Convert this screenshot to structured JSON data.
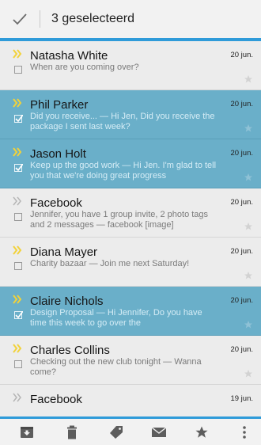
{
  "header": {
    "done_icon": "check-icon",
    "title": "3 geselecteerd",
    "accent": "#2f9bd9"
  },
  "messages": [
    {
      "sender": "Natasha White",
      "snippet": "When are you coming over?",
      "date": "20 jun.",
      "selected": false,
      "important": true
    },
    {
      "sender": "Phil Parker",
      "snippet": "Did you receive... — Hi Jen, Did you receive the package I sent last week?",
      "date": "20 jun.",
      "selected": true,
      "important": true
    },
    {
      "sender": "Jason Holt",
      "snippet": "Keep up the good work — Hi Jen. I'm glad to tell you that we're doing great progress",
      "date": "20 jun.",
      "selected": true,
      "important": true
    },
    {
      "sender": "Facebook",
      "snippet": "Jennifer, you have 1 group invite, 2 photo tags and 2 messages — facebook [image]",
      "date": "20 jun.",
      "selected": false,
      "important": false
    },
    {
      "sender": "Diana Mayer",
      "snippet": "Charity bazaar — Join me next Saturday!",
      "date": "20 jun.",
      "selected": false,
      "important": true
    },
    {
      "sender": "Claire Nichols",
      "snippet": "Design Proposal — Hi Jennifer, Do you have time this week to go over the",
      "date": "20 jun.",
      "selected": true,
      "important": true
    },
    {
      "sender": "Charles Collins",
      "snippet": "Checking out the new club tonight — Wanna come?",
      "date": "20 jun.",
      "selected": false,
      "important": true
    },
    {
      "sender": "Facebook",
      "snippet": "",
      "date": "19 jun.",
      "selected": false,
      "important": false
    }
  ],
  "colors": {
    "selected_row": "#6aafc9",
    "unselected_row": "#ececec",
    "important_marker": "#f2d23a"
  },
  "toolbar": {
    "actions": [
      "archive-icon",
      "trash-icon",
      "label-icon",
      "mark-unread-icon",
      "star-icon",
      "overflow-menu-icon"
    ]
  }
}
